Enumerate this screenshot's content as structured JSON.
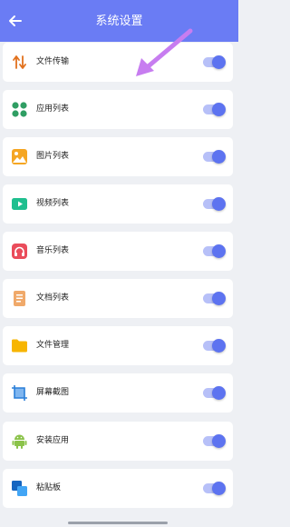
{
  "header": {
    "title": "系统设置",
    "back_icon": "arrow-left-icon",
    "background": "#6a7cf4"
  },
  "settings": [
    {
      "label": "文件传输",
      "icon": "transfer-arrows-icon",
      "enabled": true
    },
    {
      "label": "应用列表",
      "icon": "app-grid-icon",
      "enabled": true
    },
    {
      "label": "图片列表",
      "icon": "image-icon",
      "enabled": true
    },
    {
      "label": "视频列表",
      "icon": "video-icon",
      "enabled": true
    },
    {
      "label": "音乐列表",
      "icon": "headphones-icon",
      "enabled": true
    },
    {
      "label": "文档列表",
      "icon": "document-icon",
      "enabled": true
    },
    {
      "label": "文件管理",
      "icon": "folder-icon",
      "enabled": true
    },
    {
      "label": "屏幕截图",
      "icon": "screenshot-crop-icon",
      "enabled": true
    },
    {
      "label": "安装应用",
      "icon": "android-icon",
      "enabled": true
    },
    {
      "label": "粘贴板",
      "icon": "clipboard-icon",
      "enabled": true
    }
  ],
  "colors": {
    "accent": "#5d73f0",
    "toggle_track": "#b7c0f8",
    "annotation": "#c77df0"
  }
}
